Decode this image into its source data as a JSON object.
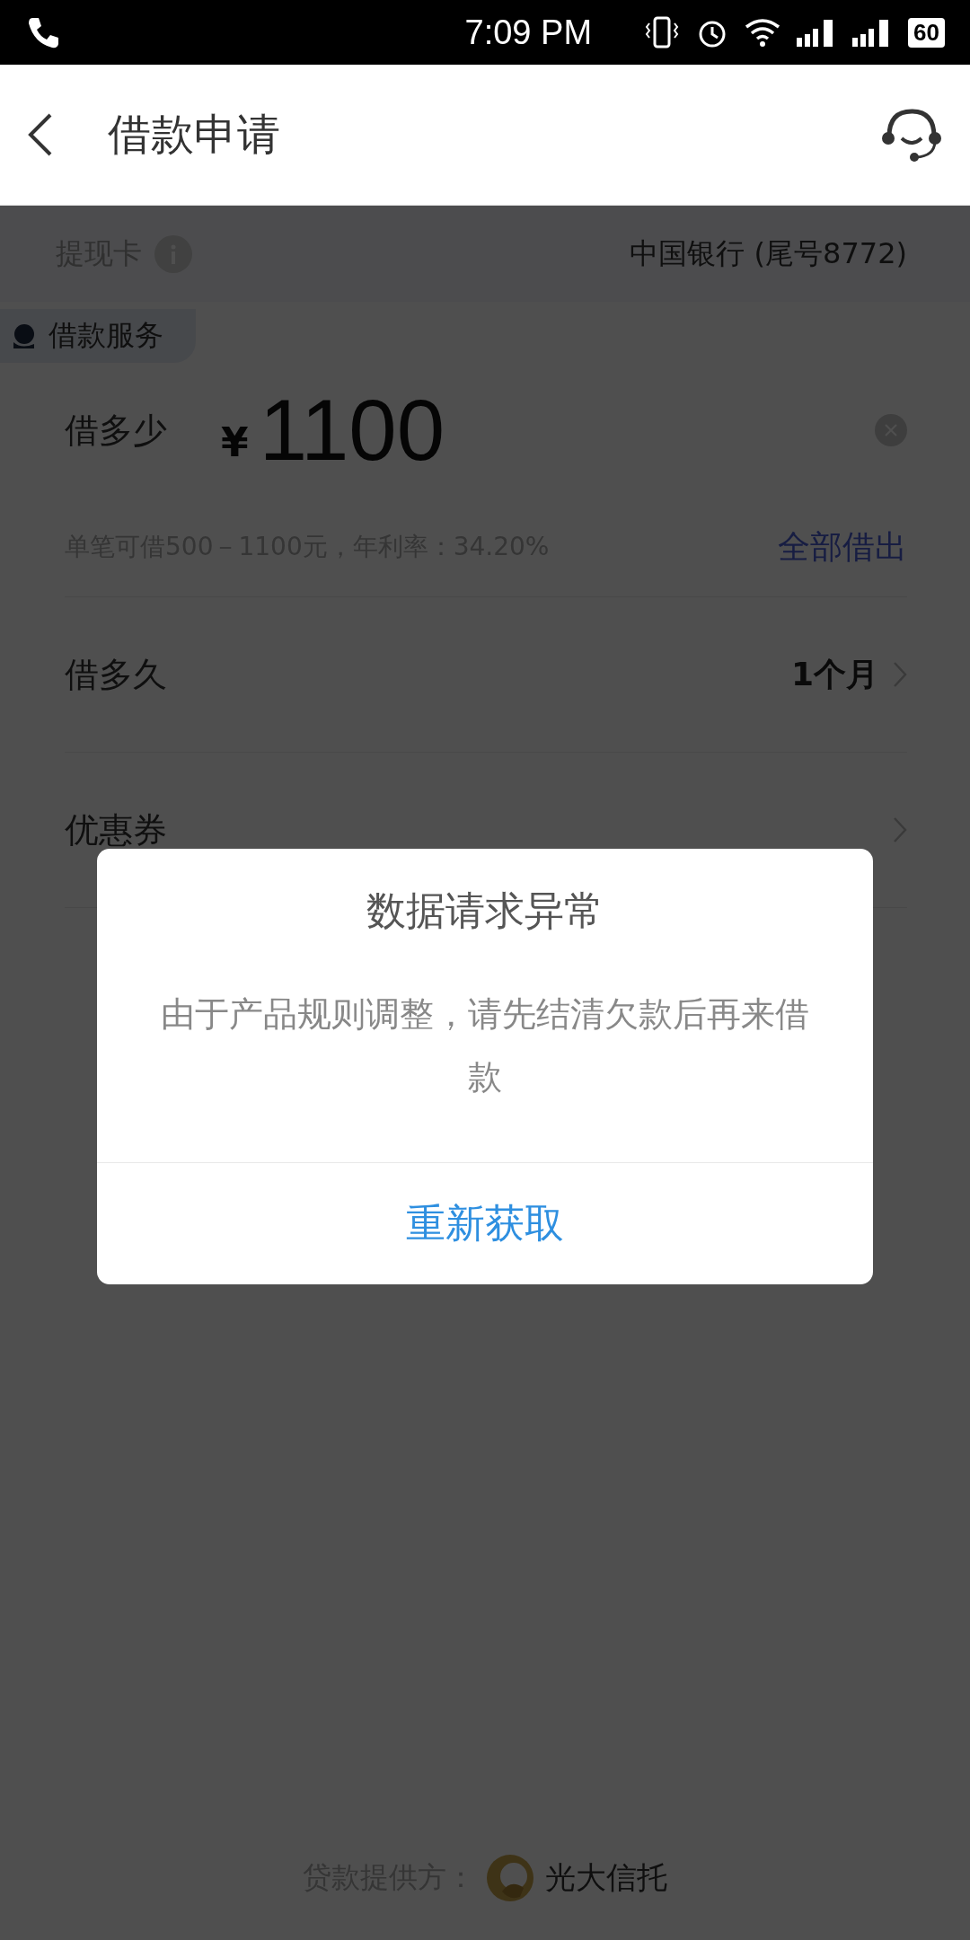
{
  "status_bar": {
    "time": "7:09 PM",
    "battery": "60"
  },
  "header": {
    "title": "借款申请"
  },
  "card_row": {
    "label": "提现卡",
    "value": "中国银行 (尾号8772)"
  },
  "service_tag": {
    "label": "借款服务"
  },
  "amount": {
    "label": "借多少",
    "currency": "¥",
    "value": "1100"
  },
  "hint": {
    "text": "单笔可借500－1100元，年利率：34.20%",
    "action": "全部借出"
  },
  "rows": [
    {
      "label": "借多久",
      "value": "1个月"
    },
    {
      "label": "优惠券"
    }
  ],
  "dialog": {
    "title": "数据请求异常",
    "message": "由于产品规则调整，请先结清欠款后再来借款",
    "button": "重新获取"
  },
  "footer": {
    "label": "贷款提供方：",
    "provider": "光大信托"
  }
}
